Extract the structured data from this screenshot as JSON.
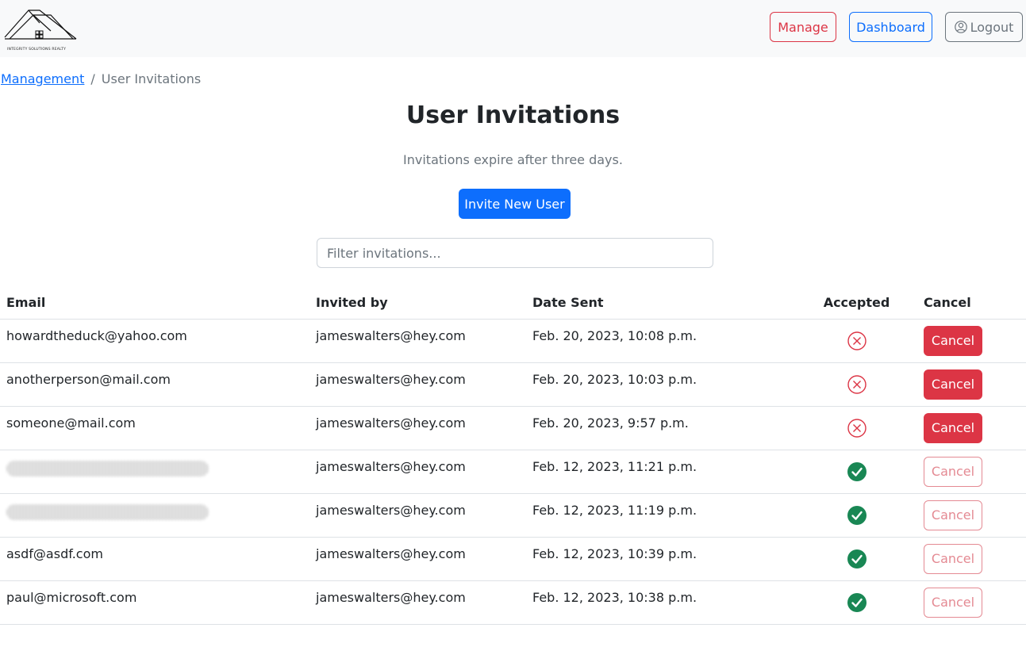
{
  "brand": {
    "logo_text": "INTEGRITY SOLUTIONS REALTY"
  },
  "nav": {
    "manage_label": "Manage",
    "dashboard_label": "Dashboard",
    "logout_label": "Logout"
  },
  "breadcrumb": {
    "parent": "Management",
    "separator": "/",
    "current": "User Invitations"
  },
  "page": {
    "title": "User Invitations",
    "subtitle": "Invitations expire after three days.",
    "invite_button": "Invite New User"
  },
  "filter": {
    "placeholder": "Filter invitations...",
    "value": ""
  },
  "table": {
    "headers": [
      "Email",
      "Invited by",
      "Date Sent",
      "Accepted",
      "Cancel"
    ],
    "rows": [
      {
        "email": "howardtheduck@yahoo.com",
        "invited_by": "jameswalters@hey.com",
        "date_sent": "Feb. 20, 2023, 10:08 p.m.",
        "accepted": false,
        "cancel_label": "Cancel"
      },
      {
        "email": "anotherperson@mail.com",
        "invited_by": "jameswalters@hey.com",
        "date_sent": "Feb. 20, 2023, 10:03 p.m.",
        "accepted": false,
        "cancel_label": "Cancel"
      },
      {
        "email": "someone@mail.com",
        "invited_by": "jameswalters@hey.com",
        "date_sent": "Feb. 20, 2023, 9:57 p.m.",
        "accepted": false,
        "cancel_label": "Cancel"
      },
      {
        "email": "",
        "email_redacted": true,
        "invited_by": "jameswalters@hey.com",
        "date_sent": "Feb. 12, 2023, 11:21 p.m.",
        "accepted": true,
        "cancel_label": "Cancel"
      },
      {
        "email": "",
        "email_redacted": true,
        "invited_by": "jameswalters@hey.com",
        "date_sent": "Feb. 12, 2023, 11:19 p.m.",
        "accepted": true,
        "cancel_label": "Cancel"
      },
      {
        "email": "asdf@asdf.com",
        "invited_by": "jameswalters@hey.com",
        "date_sent": "Feb. 12, 2023, 10:39 p.m.",
        "accepted": true,
        "cancel_label": "Cancel"
      },
      {
        "email": "paul@microsoft.com",
        "invited_by": "jameswalters@hey.com",
        "date_sent": "Feb. 12, 2023, 10:38 p.m.",
        "accepted": true,
        "cancel_label": "Cancel"
      }
    ]
  },
  "icons": {
    "not_accepted": "x-circle-icon",
    "accepted": "check-circle-icon",
    "logout": "person-circle-icon"
  },
  "colors": {
    "primary": "#0d6efd",
    "danger": "#dc3545",
    "success": "#198754",
    "secondary": "#6c757d",
    "navbar_bg": "#f8f9fa"
  }
}
